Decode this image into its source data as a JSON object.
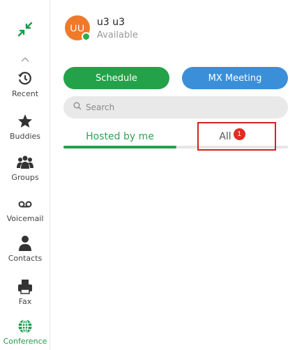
{
  "sidebar": {
    "items": [
      {
        "label": "Recent",
        "icon": "history-icon"
      },
      {
        "label": "Buddies",
        "icon": "star-icon"
      },
      {
        "label": "Groups",
        "icon": "groups-icon"
      },
      {
        "label": "Voicemail",
        "icon": "voicemail-icon"
      },
      {
        "label": "Contacts",
        "icon": "person-icon"
      },
      {
        "label": "Fax",
        "icon": "fax-icon"
      },
      {
        "label": "Conference",
        "icon": "globe-icon"
      }
    ],
    "active": "Conference",
    "accent_color": "#1a9c4a"
  },
  "user": {
    "initials": "UU",
    "name": "u3 u3",
    "status": "Available",
    "avatar_color": "#ee7a2a",
    "presence_color": "#2cae4a"
  },
  "actions": {
    "schedule_label": "Schedule",
    "mx_meeting_label": "MX Meeting",
    "schedule_color": "#24a24a",
    "mx_color": "#3b8fd9"
  },
  "search": {
    "placeholder": "Search"
  },
  "tabs": [
    {
      "label": "Hosted by me",
      "selected": true
    },
    {
      "label": "All",
      "badge": "1"
    }
  ],
  "highlight_color": "#d61f1f"
}
